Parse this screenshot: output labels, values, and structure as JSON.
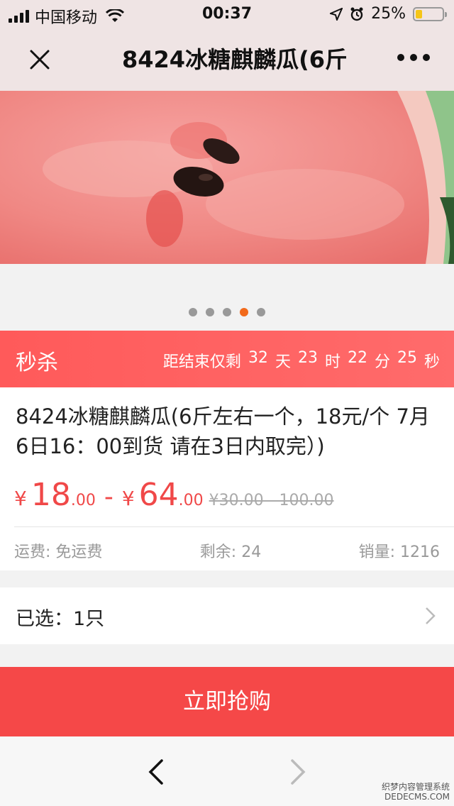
{
  "status_bar": {
    "carrier": "中国移动",
    "time": "00:37",
    "battery": "25%",
    "battery_level": 0.25
  },
  "nav": {
    "title": "8424冰糖麒麟瓜(6斤"
  },
  "carousel": {
    "dot_count": 5,
    "active_dot": 4
  },
  "flash_sale": {
    "label": "秒杀",
    "countdown_prefix": "距结束仅剩",
    "days": "32",
    "days_unit": "天",
    "hours": "23",
    "hours_unit": "时",
    "minutes": "22",
    "minutes_unit": "分",
    "seconds": "25",
    "seconds_unit": "秒"
  },
  "product": {
    "name": "8424冰糖麒麟瓜(6斤左右一个，18元/个 7月6日16：00到货 请在3日内取完）)",
    "currency": "¥",
    "price_min_int": "18",
    "price_min_dec": ".00",
    "price_max_int": "64",
    "price_max_dec": ".00",
    "price_separator": "-",
    "original_price": "¥30.00 - 100.00",
    "shipping": "运费: 免运费",
    "stock": "剩余: 24",
    "sales": "销量: 1216"
  },
  "selection": {
    "label": "已选：1只"
  },
  "buy_button": {
    "label": "立即抢购"
  },
  "watermark": {
    "line1": "织梦内容管理系统",
    "line2": "DEDECMS.COM"
  },
  "colors": {
    "accent": "#f54848",
    "price": "#f04848",
    "active_dot": "#f26a1b"
  }
}
